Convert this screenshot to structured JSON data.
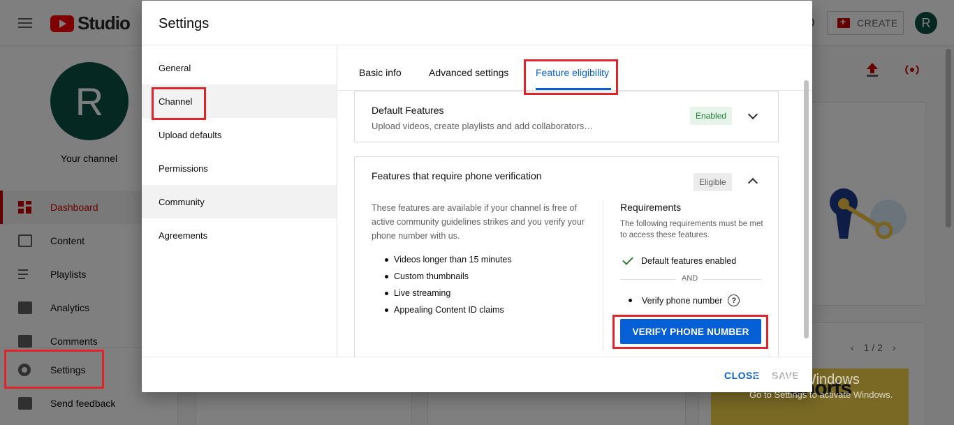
{
  "app": {
    "logo_text": "Studio",
    "create_label": "CREATE",
    "avatar_letter": "R"
  },
  "sidebar": {
    "avatar_letter": "R",
    "channel_label": "Your channel",
    "items": [
      {
        "label": "Dashboard",
        "icon": "dashboard-icon"
      },
      {
        "label": "Content",
        "icon": "content-icon"
      },
      {
        "label": "Playlists",
        "icon": "playlists-icon"
      },
      {
        "label": "Analytics",
        "icon": "analytics-icon"
      },
      {
        "label": "Comments",
        "icon": "comments-icon"
      },
      {
        "label": "Settings",
        "icon": "gear-icon"
      },
      {
        "label": "Send feedback",
        "icon": "feedback-icon"
      }
    ]
  },
  "main": {
    "pager": "1 / 2",
    "shorts_text": "Shorts"
  },
  "dialog": {
    "title": "Settings",
    "nav": [
      "General",
      "Channel",
      "Upload defaults",
      "Permissions",
      "Community",
      "Agreements"
    ],
    "tabs": [
      "Basic info",
      "Advanced settings",
      "Feature eligibility"
    ],
    "default_features": {
      "title": "Default Features",
      "subtitle": "Upload videos, create playlists and add collaborators…",
      "badge": "Enabled"
    },
    "phone_features": {
      "title": "Features that require phone verification",
      "badge": "Eligible",
      "description": "These features are available if your channel is free of active community guidelines strikes and you verify your phone number with us.",
      "list": [
        "Videos longer than 15 minutes",
        "Custom thumbnails",
        "Live streaming",
        "Appealing Content ID claims"
      ],
      "requirements_title": "Requirements",
      "requirements_sub": "The following requirements must be met to access these features.",
      "req1": "Default features enabled",
      "and_label": "AND",
      "req2": "Verify phone number",
      "help_glyph": "?",
      "verify_button": "VERIFY PHONE NUMBER"
    },
    "footer": {
      "close": "CLOSE",
      "save": "SAVE"
    }
  },
  "watermark": {
    "line1": "Activate Windows",
    "line2": "Go to Settings to activate Windows."
  },
  "colors": {
    "accent": "#065fd4",
    "brand": "#ff0000",
    "highlight_box": "#e0242b",
    "enabled_badge": "#e6f4ea"
  }
}
